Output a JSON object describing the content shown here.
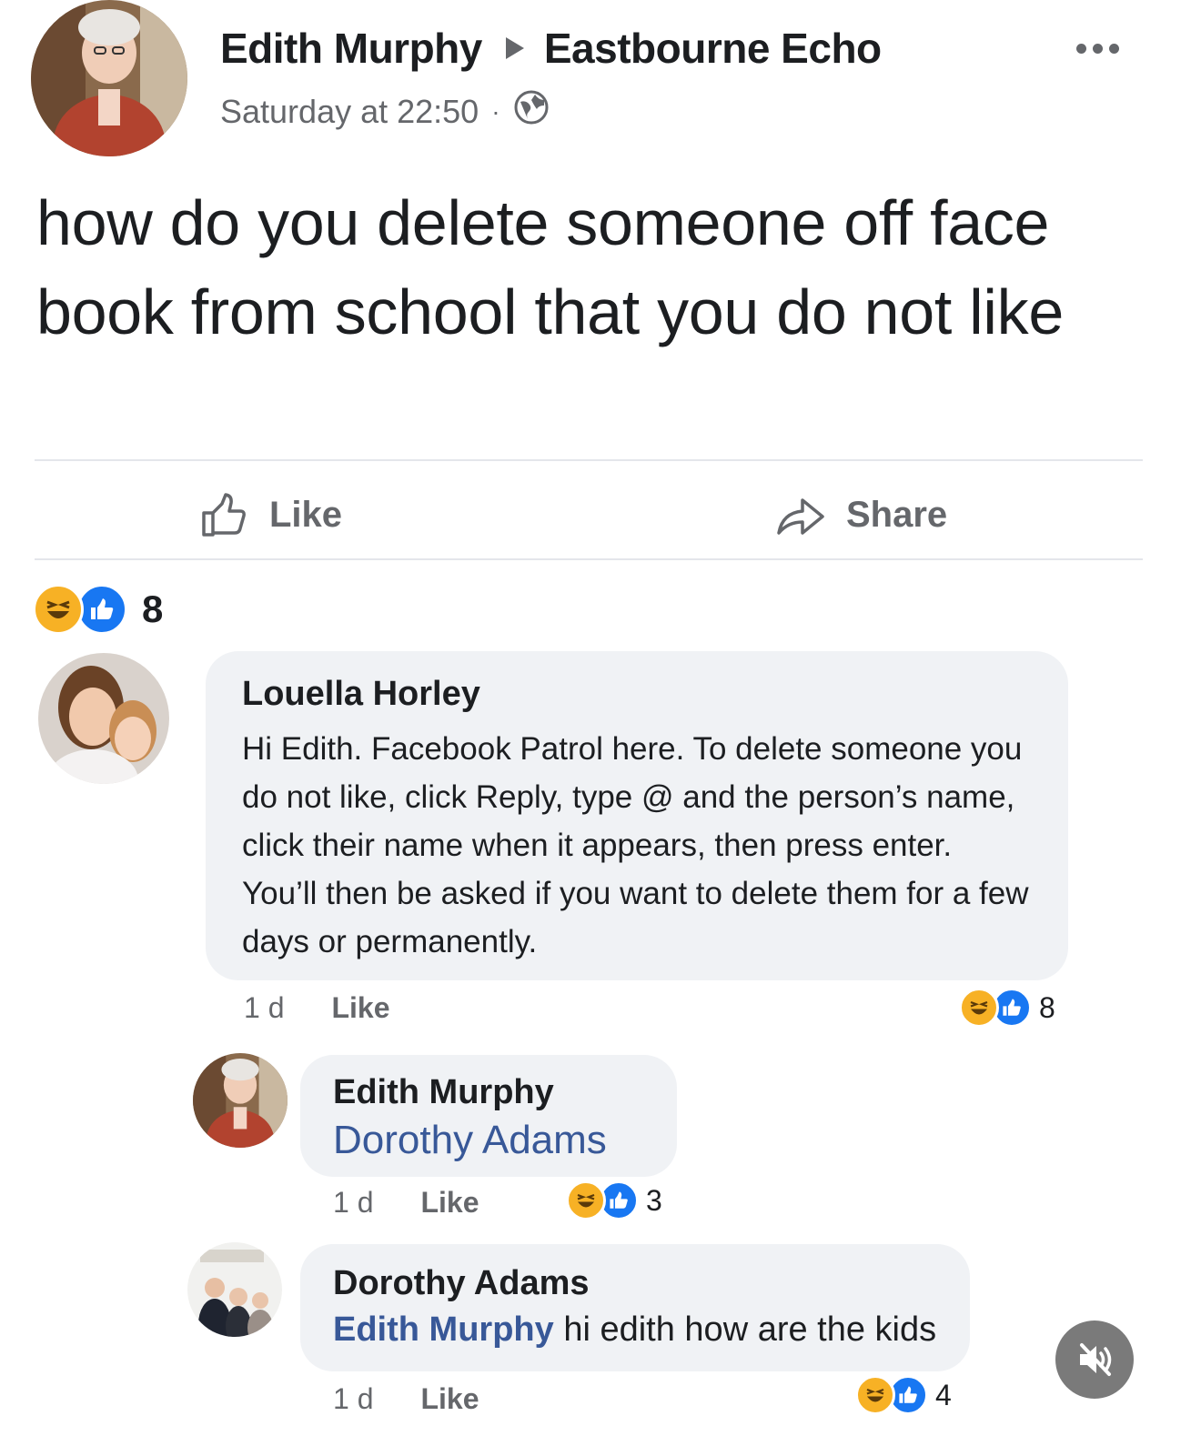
{
  "post": {
    "author": "Edith Murphy",
    "group": "Eastbourne Echo",
    "timestamp": "Saturday at 22:50",
    "meta_separator": "·",
    "privacy_icon": "globe-icon",
    "text": "how do you delete someone off face book from school that you do not like",
    "actions": {
      "like_label": "Like",
      "share_label": "Share"
    },
    "reaction_count": "8",
    "reaction_icons": [
      "haha-reaction-icon",
      "like-reaction-icon"
    ]
  },
  "comments": [
    {
      "author": "Louella Horley",
      "text": "Hi Edith. Facebook Patrol here. To delete someone you do not like, click Reply, type @ and the person’s name, click their name when it appears, then press enter. You’ll then be asked if you want to delete them for a few days or permanently.",
      "time": "1 d",
      "like_label": "Like",
      "reaction_count": "8"
    },
    {
      "author": "Edith Murphy",
      "mention": "Dorothy Adams",
      "text": "",
      "time": "1 d",
      "like_label": "Like",
      "reaction_count": "3"
    },
    {
      "author": "Dorothy Adams",
      "mention": "Edith Murphy",
      "text": "hi edith how are the kids",
      "time": "1 d",
      "like_label": "Like",
      "reaction_count": "4"
    }
  ],
  "colors": {
    "secondary_text": "#65676b",
    "bubble": "#f0f2f5",
    "mention": "#385898",
    "like_blue": "#1877f2",
    "haha_yellow": "#f7b125"
  },
  "overlay": {
    "mute_icon": "speaker-muted-icon"
  }
}
